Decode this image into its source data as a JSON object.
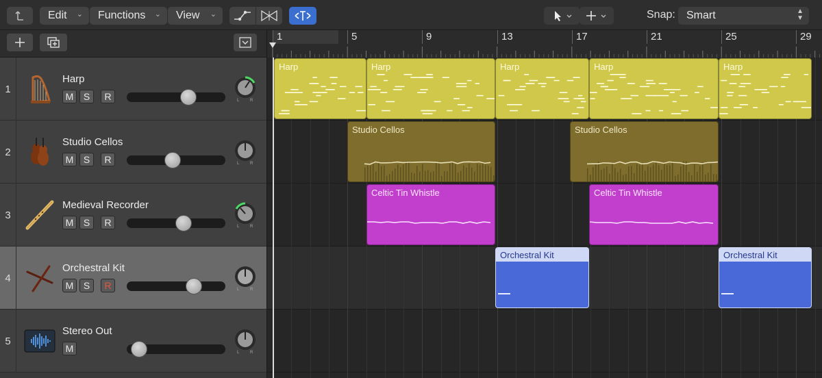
{
  "toolbar": {
    "edit_label": "Edit",
    "functions_label": "Functions",
    "view_label": "View",
    "snap_label": "Snap:",
    "snap_value": "Smart"
  },
  "ruler": {
    "bars": [
      "1",
      "5",
      "9",
      "13",
      "17",
      "21",
      "25",
      "29"
    ]
  },
  "tracks": [
    {
      "number": "1",
      "name": "Harp",
      "buttons": [
        "M",
        "S",
        "R"
      ],
      "volume": 0.65,
      "icon": "harp-icon"
    },
    {
      "number": "2",
      "name": "Studio Cellos",
      "buttons": [
        "M",
        "S",
        "R"
      ],
      "volume": 0.46,
      "icon": "cello-icon"
    },
    {
      "number": "3",
      "name": "Medieval Recorder",
      "buttons": [
        "M",
        "S",
        "R"
      ],
      "volume": 0.59,
      "icon": "recorder-icon"
    },
    {
      "number": "4",
      "name": "Orchestral Kit",
      "buttons": [
        "M",
        "S",
        "R"
      ],
      "volume": 0.72,
      "icon": "drumsticks-icon"
    },
    {
      "number": "5",
      "name": "Stereo Out",
      "buttons": [
        "M"
      ],
      "volume": 0.05,
      "icon": "waveform-icon"
    }
  ],
  "pan_labels": {
    "left": "L",
    "right": "R"
  },
  "regions": {
    "harp": [
      "Harp",
      "Harp",
      "Harp",
      "Harp",
      "Harp"
    ],
    "cellos": [
      "Studio Cellos",
      "Studio Cellos"
    ],
    "whistle": [
      "Celtic Tin Whistle",
      "Celtic Tin Whistle"
    ],
    "kit": [
      "Orchestral Kit",
      "Orchestral Kit"
    ]
  },
  "colors": {
    "harp": "#cfc84a",
    "cellos": "#7e6d2c",
    "whistle": "#c13fcc",
    "kit": "#4a69d8",
    "selected_tool": "#3a6fd0",
    "pan_indicator": "#4cd964"
  }
}
